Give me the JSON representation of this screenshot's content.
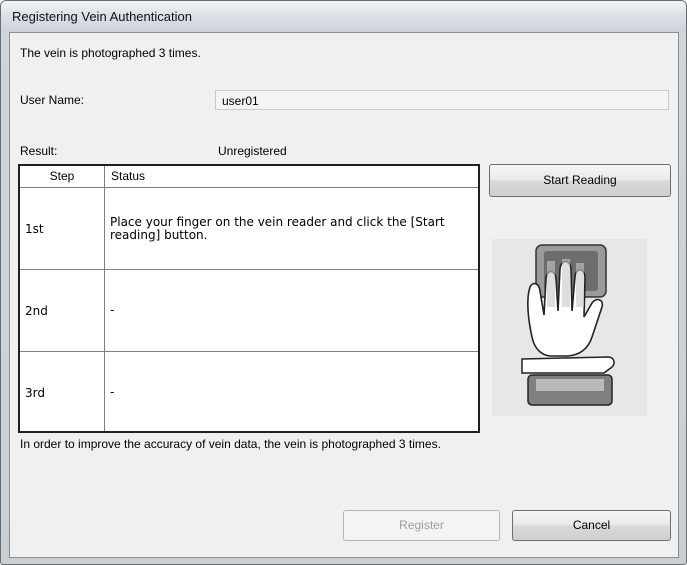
{
  "window": {
    "title": "Registering Vein Authentication"
  },
  "intro_text": "The vein is photographed 3 times.",
  "user": {
    "label": "User Name:",
    "value": "user01"
  },
  "result": {
    "label": "Result:",
    "value": "Unregistered"
  },
  "table": {
    "headers": [
      "Step",
      "Status"
    ],
    "rows": [
      {
        "step": "1st",
        "status": "Place your finger on the vein reader and click the [Start reading] button."
      },
      {
        "step": "2nd",
        "status": "-"
      },
      {
        "step": "3rd",
        "status": "-"
      }
    ]
  },
  "footer_note": "In order to improve the accuracy of vein data, the vein is photographed 3 times.",
  "buttons": {
    "start_reading": "Start Reading",
    "register": "Register",
    "cancel": "Cancel"
  },
  "image": {
    "icon": "palm-vein-reader-illustration"
  }
}
